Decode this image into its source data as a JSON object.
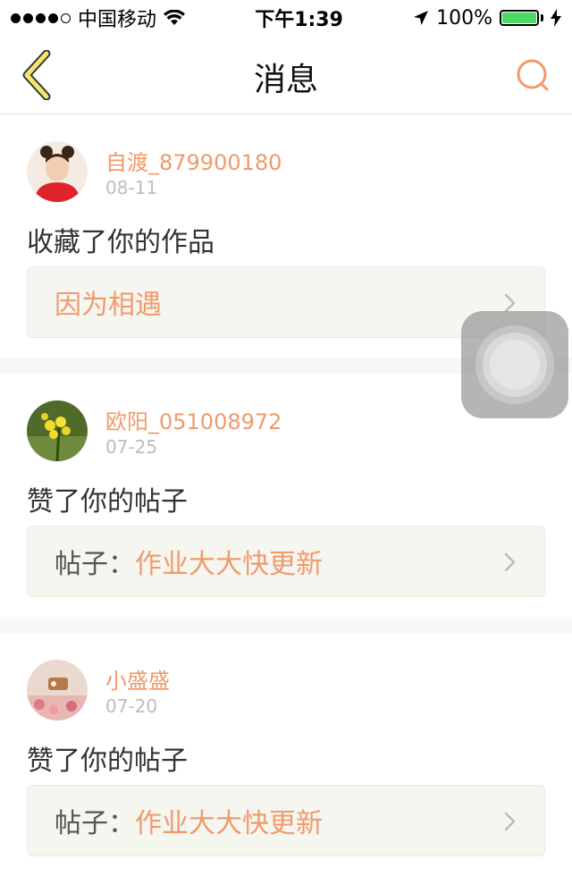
{
  "status_bar": {
    "carrier": "中国移动",
    "time": "下午1:39",
    "battery": "100%",
    "battery_level": 1.0,
    "signal_filled": 4,
    "signal_total": 5,
    "icons": [
      "wifi-icon",
      "location-arrow-icon",
      "battery-icon",
      "charging-bolt-icon"
    ]
  },
  "nav": {
    "title": "消息",
    "back_icon": "chevron-left-icon",
    "search_icon": "search-icon"
  },
  "colors": {
    "accent": "#f09a6b",
    "back_fill": "#f5e66b",
    "battery": "#4cd964"
  },
  "messages": [
    {
      "user": "自渡_879900180",
      "date": "08-11",
      "action": "收藏了你的作品",
      "ref_prefix": "",
      "ref_title": "因为相遇",
      "avatar": "avatar-girl-red-shirt"
    },
    {
      "user": "欧阳_051008972",
      "date": "07-25",
      "action": "赞了你的帖子",
      "ref_prefix": "帖子：",
      "ref_title": "作业大大快更新",
      "avatar": "avatar-yellow-flower"
    },
    {
      "user": "小盛盛",
      "date": "07-20",
      "action": "赞了你的帖子",
      "ref_prefix": "帖子：",
      "ref_title": "作业大大快更新",
      "avatar": "avatar-pink-flowers"
    }
  ]
}
